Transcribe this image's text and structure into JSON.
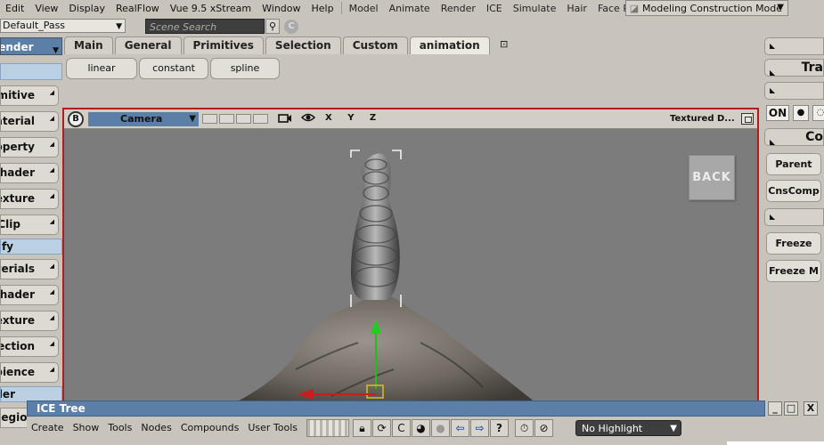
{
  "menubar": {
    "items": [
      "Edit",
      "View",
      "Display",
      "RealFlow",
      "Vue 9.5 xStream",
      "Window",
      "Help"
    ],
    "modules": [
      "Model",
      "Animate",
      "Render",
      "ICE",
      "Simulate",
      "Hair",
      "Face Robot"
    ],
    "mode": "Modeling Construction Mode"
  },
  "pass": {
    "value": "Default_Pass"
  },
  "search": {
    "placeholder": "Scene Search"
  },
  "left_panel": {
    "header": "Render",
    "buttons": [
      "Primitive",
      "Material",
      "Property",
      "Shader",
      "Texture",
      "Clip"
    ],
    "section": "Modify",
    "buttons2": [
      "Materials",
      "Shader",
      "Texture",
      "Projection",
      "Ambience"
    ],
    "section2": "Render",
    "last": "Region"
  },
  "tabs": [
    "Main",
    "General",
    "Primitives",
    "Selection",
    "Custom",
    "animation"
  ],
  "active_tab": "animation",
  "tools": [
    "linear",
    "constant",
    "spline"
  ],
  "viewport": {
    "camera": "Camera",
    "axes": "X Y Z",
    "shading": "Textured D...",
    "back": "BACK",
    "b_label": "B"
  },
  "right_panel": {
    "title1": "Tra",
    "on_label": "ON",
    "title2": "Co",
    "buttons1": [
      "Parent",
      "CnsComp"
    ],
    "buttons2": [
      "Freeze",
      "Freeze M"
    ]
  },
  "ice_tree": {
    "title": "ICE Tree",
    "menu": [
      "Create",
      "Show",
      "Tools",
      "Nodes",
      "Compounds",
      "User Tools"
    ],
    "highlight": "No Highlight",
    "window_buttons": [
      "_",
      "□",
      "X"
    ]
  },
  "colors": {
    "accent_blue": "#5b7fa6",
    "viewport_border": "#b21c1c",
    "viewport_bg": "#7c7c7c",
    "ui_bg": "#c8c4bc"
  }
}
